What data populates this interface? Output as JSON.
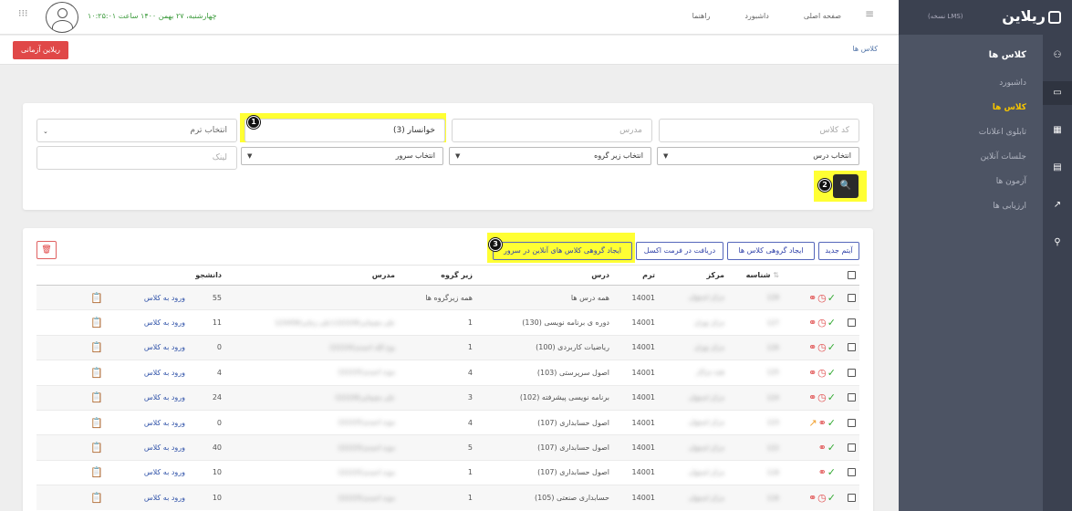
{
  "brand": {
    "logo_text": "ریلاین",
    "edition": "(نسخه LMS)"
  },
  "sidebar": {
    "title": "کلاس ها",
    "items": [
      {
        "label": "داشبورد",
        "active": false
      },
      {
        "label": "کلاس ها",
        "active": true
      },
      {
        "label": "تابلوی اعلانات",
        "active": false
      },
      {
        "label": "جلسات آنلاین",
        "active": false
      },
      {
        "label": "آزمون ها",
        "active": false
      },
      {
        "label": "ارزیابی ها",
        "active": false
      }
    ],
    "rail_icons": [
      "user-icon",
      "monitor-icon",
      "grid-icon",
      "document-icon",
      "chart-icon",
      "person-plus-icon"
    ]
  },
  "header": {
    "datetime": "چهارشنبه، ۲۷ بهمن ۱۴۰۰ ساعت ۱۰:۲۵:۰۱",
    "nav": [
      "صفحه اصلی",
      "داشبورد",
      "راهنما"
    ]
  },
  "breadcrumb": "کلاس ها",
  "demo_button": "ریلاین آزمانی",
  "filters": {
    "class_code_placeholder": "کد کلاس",
    "teacher_placeholder": "مدرس",
    "khansar_value": "خوانسار (3)",
    "term_placeholder": "انتخاب ترم",
    "course_select": "انتخاب درس",
    "subgroup_select": "انتخاب زیر گروه",
    "server_select": "انتخاب سرور",
    "link_placeholder": "لینک"
  },
  "markers": [
    "1",
    "2",
    "3"
  ],
  "toolbar": {
    "new_item": "آیتم جدید",
    "bulk_create": "ایجاد گروهی کلاس ها",
    "export_excel": "دریافت در فرمت اکسل",
    "bulk_online": "ایجاد گروهی کلاس های آنلاین در سرور"
  },
  "table": {
    "headers": {
      "id": "شناسه",
      "center": "مرکز",
      "term": "ترم",
      "course": "درس",
      "subgroup": "زیر گروه",
      "teacher": "مدرس",
      "students": "دانشجو"
    },
    "enter_label": "ورود به کلاس",
    "rows": [
      {
        "id": "128",
        "center": "مرکز اصفهان",
        "term": "14001",
        "course": "همه درس ها",
        "subgroup": "همه زیرگروه ها",
        "teacher": "",
        "students": "55",
        "icons": "full"
      },
      {
        "id": "127",
        "center": "مرکز تهران",
        "term": "14001",
        "course": "دوره ی برنامه نویسی (130)",
        "subgroup": "1",
        "teacher": "علی مقیمانی(22228)،(علی زمانی(123456",
        "students": "11",
        "icons": "full"
      },
      {
        "id": "126",
        "center": "مرکز تهران",
        "term": "14001",
        "course": "ریاضیات کاربردی (100)",
        "subgroup": "1",
        "teacher": "یوح الله احمدی(22224)",
        "students": "0",
        "icons": "full"
      },
      {
        "id": "125",
        "center": "همه مراکز",
        "term": "14001",
        "course": "اصول سرپرستی (103)",
        "subgroup": "4",
        "teacher": "مونه احمدی(22225)",
        "students": "4",
        "icons": "full"
      },
      {
        "id": "124",
        "center": "مرکز اصفهان",
        "term": "14001",
        "course": "برنامه نویسی پیشرفته (102)",
        "subgroup": "3",
        "teacher": "علی مقیمانی(22228)",
        "students": "24",
        "icons": "full"
      },
      {
        "id": "123",
        "center": "مرکز اصفهان",
        "term": "14001",
        "course": "اصول حسابداری (107)",
        "subgroup": "4",
        "teacher": "مونه احمدی(22225)",
        "students": "0",
        "icons": "link"
      },
      {
        "id": "122",
        "center": "مرکز اصفهان",
        "term": "14001",
        "course": "اصول حسابداری (107)",
        "subgroup": "5",
        "teacher": "مونه احمدی(22225)",
        "students": "40",
        "icons": "short"
      },
      {
        "id": "118",
        "center": "مرکز اصفهان",
        "term": "14001",
        "course": "اصول حسابداری (107)",
        "subgroup": "1",
        "teacher": "مونه احمدی(22225)",
        "students": "10",
        "icons": "short"
      },
      {
        "id": "116",
        "center": "مرکز اصفهان",
        "term": "14001",
        "course": "حسابداری صنعتی (105)",
        "subgroup": "1",
        "teacher": "مونه احمدی(22225)",
        "students": "10",
        "icons": "full"
      }
    ]
  }
}
